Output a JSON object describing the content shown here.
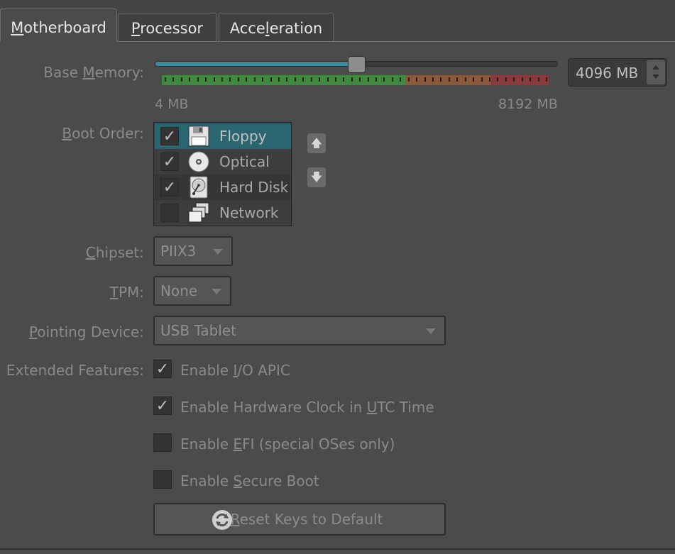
{
  "tabs": [
    {
      "label_pre": "",
      "label_u": "M",
      "label_post": "otherboard",
      "active": true
    },
    {
      "label_pre": "",
      "label_u": "P",
      "label_post": "rocessor",
      "active": false
    },
    {
      "label_pre": "Acce",
      "label_u": "l",
      "label_post": "eration",
      "active": false
    }
  ],
  "base_memory": {
    "label_pre": "Base ",
    "label_u": "M",
    "label_post": "emory:",
    "min_label": "4 MB",
    "max_label": "8192 MB",
    "value": "4096 MB",
    "slider_fraction": 0.5
  },
  "boot_order": {
    "label_pre": "",
    "label_u": "B",
    "label_post": "oot Order:",
    "items": [
      {
        "name": "Floppy",
        "checked": true,
        "icon": "floppy-icon"
      },
      {
        "name": "Optical",
        "checked": true,
        "icon": "optical-disc-icon"
      },
      {
        "name": "Hard Disk",
        "checked": true,
        "icon": "hard-disk-icon"
      },
      {
        "name": "Network",
        "checked": false,
        "icon": "network-icon"
      }
    ]
  },
  "chipset": {
    "label_pre": "",
    "label_u": "C",
    "label_post": "hipset:",
    "value": "PIIX3"
  },
  "tpm": {
    "label_pre": "",
    "label_u": "T",
    "label_post": "PM:",
    "value": "None"
  },
  "pointing": {
    "label_pre": "",
    "label_u": "P",
    "label_post": "ointing Device:",
    "value": "USB Tablet"
  },
  "extended": {
    "label": "Extended Features:",
    "options": [
      {
        "pre": "Enable ",
        "u": "I",
        "post": "/O APIC",
        "checked": true
      },
      {
        "pre": "Enable Hardware Clock in ",
        "u": "U",
        "post": "TC Time",
        "checked": true
      },
      {
        "pre": "Enable ",
        "u": "E",
        "post": "FI (special OSes only)",
        "checked": false
      },
      {
        "pre": "Enable ",
        "u": "S",
        "post": "ecure Boot",
        "checked": false
      }
    ]
  },
  "reset_button": {
    "pre": "",
    "u": "R",
    "post": "eset Keys to Default"
  },
  "colors": {
    "accent": "#2a6670",
    "slider_fill": "#3a8d99",
    "scale_green": "#3f8a3f",
    "scale_orange": "#8a5a3a",
    "scale_red": "#8a3a3a"
  }
}
